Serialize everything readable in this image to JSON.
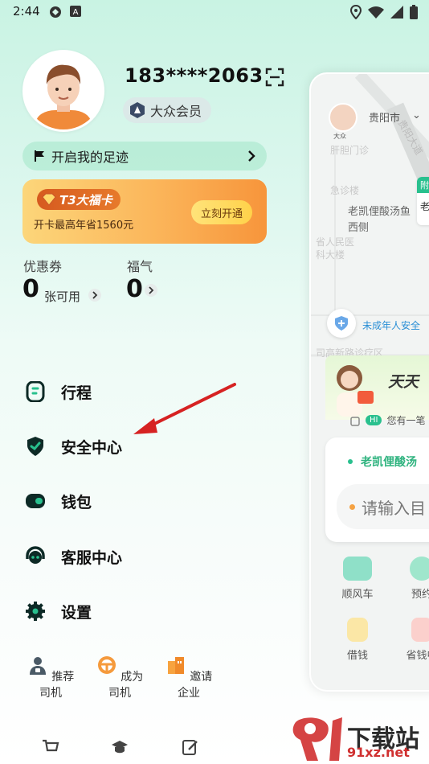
{
  "status_bar": {
    "time": "2:44"
  },
  "profile": {
    "phone": "183****2063",
    "member_label": "大众会员"
  },
  "footprint": {
    "label": "开启我的足迹"
  },
  "card": {
    "title": "T3大福卡",
    "subtitle": "开卡最高年省1560元",
    "button": "立刻开通"
  },
  "stats": [
    {
      "label": "优惠券",
      "value": "0",
      "unit": "张可用"
    },
    {
      "label": "福气",
      "value": "0",
      "unit": ""
    }
  ],
  "menu": [
    {
      "label": "行程",
      "icon": "trip-icon"
    },
    {
      "label": "安全中心",
      "icon": "shield-icon"
    },
    {
      "label": "钱包",
      "icon": "wallet-icon"
    },
    {
      "label": "客服中心",
      "icon": "headset-icon"
    },
    {
      "label": "设置",
      "icon": "gear-icon"
    }
  ],
  "quick_actions": [
    {
      "label": "推荐司机",
      "icon": "driver-icon"
    },
    {
      "label": "成为司机",
      "icon": "steering-wheel-icon"
    },
    {
      "label": "邀请企业",
      "icon": "building-icon"
    }
  ],
  "map_preview": {
    "city": "贵阳市",
    "avatar_badge": "大众",
    "road_label": "贵阳大道",
    "poi_1": "肝胆门诊",
    "poi_2": "急诊楼",
    "poi_3": "老凯俚酸汤鱼",
    "poi_3b": "西侧",
    "poi_4": "省人民医",
    "poi_5": "科大楼",
    "poi_6": "司高新路诊疗区",
    "tag_head": "附",
    "tag_body": "老",
    "shield_text": "未成年人安全",
    "banner_text": "天天",
    "hi_badge": "HI",
    "hi_text": "您有一笔",
    "dest": "老凯俚酸汤",
    "input_placeholder": "请输入目",
    "grid": [
      {
        "label": "顺风车"
      },
      {
        "label": "预约"
      },
      {
        "label": "借钱"
      },
      {
        "label": "省钱中"
      }
    ]
  },
  "watermark": {
    "text": "下载站",
    "url": "91xz.net"
  },
  "colors": {
    "accent_green": "#29c08e",
    "arrow_red": "#d62222",
    "card_orange": "#f7953b"
  }
}
